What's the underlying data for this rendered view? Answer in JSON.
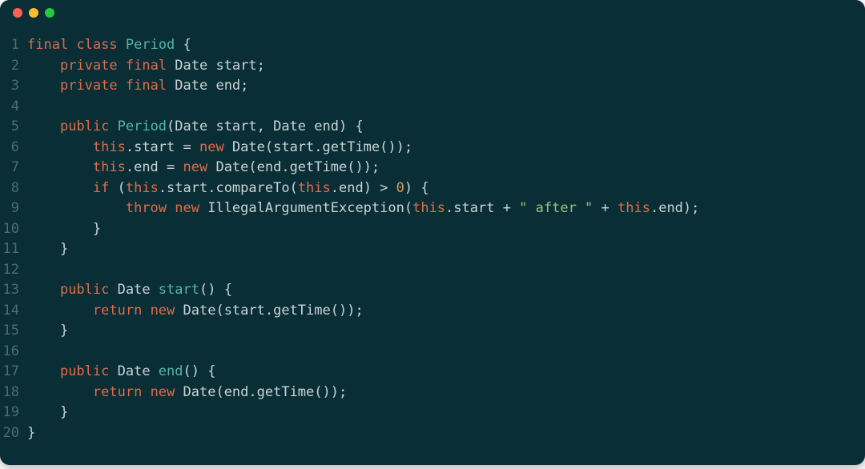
{
  "colors": {
    "background": "#0a2e36",
    "gutter": "#4f6b70",
    "default_text": "#c9d4d5",
    "keyword": "#e06c4b",
    "class_name": "#56b6a6",
    "number": "#d19a66",
    "string": "#98c379"
  },
  "traffic_lights": [
    "close",
    "minimize",
    "zoom"
  ],
  "code_lines": [
    {
      "num": "1",
      "indent": 0,
      "tokens": [
        [
          "kw",
          "final"
        ],
        [
          "tok",
          " "
        ],
        [
          "kw",
          "class"
        ],
        [
          "tok",
          " "
        ],
        [
          "cls",
          "Period"
        ],
        [
          "tok",
          " {"
        ]
      ]
    },
    {
      "num": "2",
      "indent": 1,
      "tokens": [
        [
          "kw",
          "private"
        ],
        [
          "tok",
          " "
        ],
        [
          "kw",
          "final"
        ],
        [
          "tok",
          " Date start;"
        ]
      ]
    },
    {
      "num": "3",
      "indent": 1,
      "tokens": [
        [
          "kw",
          "private"
        ],
        [
          "tok",
          " "
        ],
        [
          "kw",
          "final"
        ],
        [
          "tok",
          " Date end;"
        ]
      ]
    },
    {
      "num": "4",
      "indent": 0,
      "tokens": []
    },
    {
      "num": "5",
      "indent": 1,
      "tokens": [
        [
          "kw",
          "public"
        ],
        [
          "tok",
          " "
        ],
        [
          "cls",
          "Period"
        ],
        [
          "tok",
          "(Date start, Date end) {"
        ]
      ]
    },
    {
      "num": "6",
      "indent": 2,
      "tokens": [
        [
          "kw",
          "this"
        ],
        [
          "tok",
          ".start = "
        ],
        [
          "kw",
          "new"
        ],
        [
          "tok",
          " Date(start.getTime());"
        ]
      ]
    },
    {
      "num": "7",
      "indent": 2,
      "tokens": [
        [
          "kw",
          "this"
        ],
        [
          "tok",
          ".end = "
        ],
        [
          "kw",
          "new"
        ],
        [
          "tok",
          " Date(end.getTime());"
        ]
      ]
    },
    {
      "num": "8",
      "indent": 2,
      "tokens": [
        [
          "kw",
          "if"
        ],
        [
          "tok",
          " ("
        ],
        [
          "kw",
          "this"
        ],
        [
          "tok",
          ".start.compareTo("
        ],
        [
          "kw",
          "this"
        ],
        [
          "tok",
          ".end) > "
        ],
        [
          "num",
          "0"
        ],
        [
          "tok",
          ") {"
        ]
      ]
    },
    {
      "num": "9",
      "indent": 3,
      "tokens": [
        [
          "kw",
          "throw"
        ],
        [
          "tok",
          " "
        ],
        [
          "kw",
          "new"
        ],
        [
          "tok",
          " IllegalArgumentException("
        ],
        [
          "kw",
          "this"
        ],
        [
          "tok",
          ".start + "
        ],
        [
          "str",
          "\" after \""
        ],
        [
          "tok",
          " + "
        ],
        [
          "kw",
          "this"
        ],
        [
          "tok",
          ".end);"
        ]
      ]
    },
    {
      "num": "10",
      "indent": 2,
      "tokens": [
        [
          "tok",
          "}"
        ]
      ]
    },
    {
      "num": "11",
      "indent": 1,
      "tokens": [
        [
          "tok",
          "}"
        ]
      ]
    },
    {
      "num": "12",
      "indent": 0,
      "tokens": []
    },
    {
      "num": "13",
      "indent": 1,
      "tokens": [
        [
          "kw",
          "public"
        ],
        [
          "tok",
          " Date "
        ],
        [
          "cls",
          "start"
        ],
        [
          "tok",
          "() {"
        ]
      ]
    },
    {
      "num": "14",
      "indent": 2,
      "tokens": [
        [
          "kw",
          "return"
        ],
        [
          "tok",
          " "
        ],
        [
          "kw",
          "new"
        ],
        [
          "tok",
          " Date(start.getTime());"
        ]
      ]
    },
    {
      "num": "15",
      "indent": 1,
      "tokens": [
        [
          "tok",
          "}"
        ]
      ]
    },
    {
      "num": "16",
      "indent": 0,
      "tokens": []
    },
    {
      "num": "17",
      "indent": 1,
      "tokens": [
        [
          "kw",
          "public"
        ],
        [
          "tok",
          " Date "
        ],
        [
          "cls",
          "end"
        ],
        [
          "tok",
          "() {"
        ]
      ]
    },
    {
      "num": "18",
      "indent": 2,
      "tokens": [
        [
          "kw",
          "return"
        ],
        [
          "tok",
          " "
        ],
        [
          "kw",
          "new"
        ],
        [
          "tok",
          " Date(end.getTime());"
        ]
      ]
    },
    {
      "num": "19",
      "indent": 1,
      "tokens": [
        [
          "tok",
          "}"
        ]
      ]
    },
    {
      "num": "20",
      "indent": 0,
      "tokens": [
        [
          "tok",
          "}"
        ]
      ]
    }
  ]
}
